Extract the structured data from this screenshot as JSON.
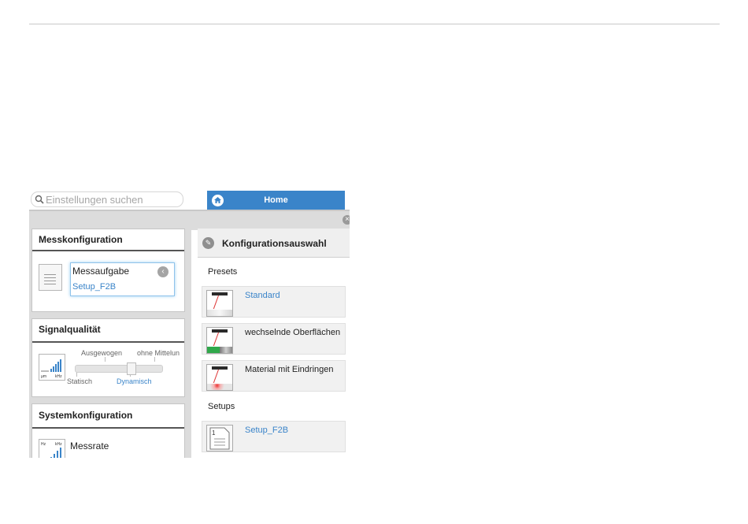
{
  "search": {
    "placeholder": "Einstellungen suchen"
  },
  "nav": {
    "home_label": "Home"
  },
  "left": {
    "messkonfiguration": {
      "title": "Messkonfiguration",
      "item_label": "Messaufgabe",
      "item_value": "Setup_F2B"
    },
    "signalqualitaet": {
      "title": "Signalqualität",
      "icon_units": [
        "µm",
        "kHz"
      ],
      "slider_labels_top": [
        "Ausgewogen",
        "ohne Mittelun"
      ],
      "slider_labels_bottom": [
        "Statisch",
        "Dynamisch"
      ],
      "selected": "Dynamisch"
    },
    "systemkonfiguration": {
      "title": "Systemkonfiguration",
      "icon_units": [
        "Hz",
        "kHz"
      ],
      "item_label": "Messrate"
    }
  },
  "right": {
    "title": "Konfigurationsauswahl",
    "presets_label": "Presets",
    "presets": [
      "Standard",
      "wechselnde Oberflächen",
      "Material mit Eindringen"
    ],
    "setups_label": "Setups",
    "setups": [
      "Setup_F2B"
    ],
    "setup_icon_number": "1"
  },
  "colors": {
    "accent": "#3a84c9",
    "panel_bg": "#dcdcdc"
  }
}
